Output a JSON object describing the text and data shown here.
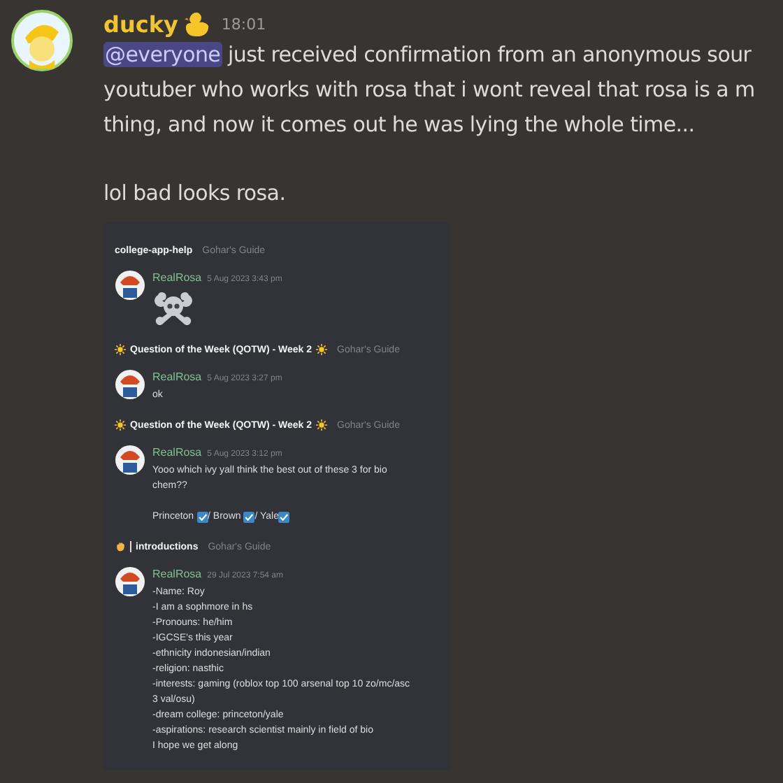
{
  "message": {
    "author": "ducky",
    "time": "18:01",
    "mention": "@everyone",
    "lines": [
      " just received confirmation from an anonymous sour",
      "youtuber who works with rosa that i wont reveal that rosa is a m",
      "thing, and now it comes out he was lying the whole time..."
    ],
    "closing": "lol bad looks rosa.",
    "attachment": {
      "kind": "screenshot",
      "blocks": [
        {
          "kind": "plain_header",
          "channel": "college-app-help",
          "server": "Gohar's Guide"
        },
        {
          "kind": "emoji_message",
          "author": "RealRosa",
          "date": "5 Aug 2023 3:43 pm"
        },
        {
          "kind": "sun_header",
          "channel": "Question of the Week (QOTW) - Week 2",
          "server": "Gohar's Guide"
        },
        {
          "kind": "text_message",
          "author": "RealRosa",
          "date": "5 Aug 2023 3:27 pm",
          "paragraphs": [
            [
              "ok"
            ]
          ]
        },
        {
          "kind": "sun_header",
          "channel": "Question of the Week (QOTW) - Week 2",
          "server": "Gohar's Guide"
        },
        {
          "kind": "text_message",
          "author": "RealRosa",
          "date": "5 Aug 2023 3:12 pm",
          "paragraphs": [
            [
              "Yooo which ivy yall think the best out of these 3 for bio",
              "chem??"
            ],
            [
              {
                "parts": [
                  {
                    "kind": "text",
                    "text": "Princeton "
                  },
                  {
                    "kind": "check"
                  },
                  {
                    "kind": "text",
                    "text": "/ Brown "
                  },
                  {
                    "kind": "check"
                  },
                  {
                    "kind": "text",
                    "text": "/ Yale"
                  },
                  {
                    "kind": "check"
                  }
                ]
              }
            ]
          ]
        },
        {
          "kind": "hand_header",
          "channel": "introductions",
          "server": "Gohar's Guide"
        },
        {
          "kind": "text_message",
          "author": "RealRosa",
          "date": "29 Jul 2023 7:54 am",
          "paragraphs": [
            [
              "-Name: Roy",
              "-I am a sophmore in hs",
              "-Pronouns: he/him",
              "-IGCSE's this year",
              "-ethnicity indonesian/indian",
              "-religion: nasthic",
              "-interests: gaming (roblox top 100 arsenal top 10 zo/mc/asc",
              "3 val/osu)",
              "-dream college: princeton/yale",
              "-aspirations: research scientist mainly in field of bio",
              "I hope we get along"
            ]
          ]
        }
      ]
    }
  }
}
